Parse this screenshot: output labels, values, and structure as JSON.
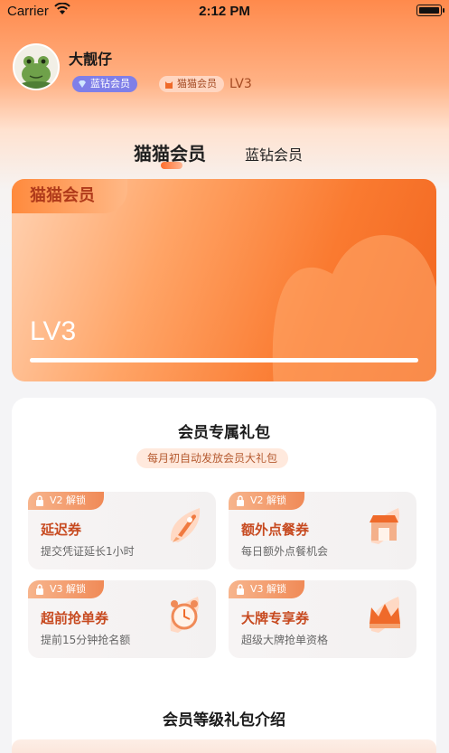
{
  "status_bar": {
    "carrier": "Carrier",
    "time": "2:12 PM"
  },
  "profile": {
    "username": "大靓仔",
    "badge_diamond": "蓝钻会员",
    "badge_cat": "猫猫会员",
    "level": "LV3"
  },
  "tabs": {
    "cat_member": "猫猫会员",
    "diamond_member": "蓝钻会员"
  },
  "level_card": {
    "tag": "猫猫会员",
    "level": "LV3",
    "progress": 1.0
  },
  "gift_section": {
    "title": "会员专属礼包",
    "subtitle": "每月初自动发放会员大礼包",
    "coupons": [
      {
        "lock": "V2 解锁",
        "title": "延迟券",
        "desc": "提交凭证延长1小时",
        "icon": "rocket-icon"
      },
      {
        "lock": "V2 解锁",
        "title": "额外点餐券",
        "desc": "每日额外点餐机会",
        "icon": "store-icon"
      },
      {
        "lock": "V3 解锁",
        "title": "超前抢单券",
        "desc": "提前15分钟抢名额",
        "icon": "alarm-clock-icon"
      },
      {
        "lock": "V3 解锁",
        "title": "大牌专享券",
        "desc": "超级大牌抢单资格",
        "icon": "crown-icon"
      }
    ]
  },
  "level_intro": {
    "title": "会员等级礼包介绍"
  },
  "colors": {
    "accent": "#f16620",
    "coupon_title": "#c74a20",
    "diamond_badge": "#7f7fe8"
  }
}
